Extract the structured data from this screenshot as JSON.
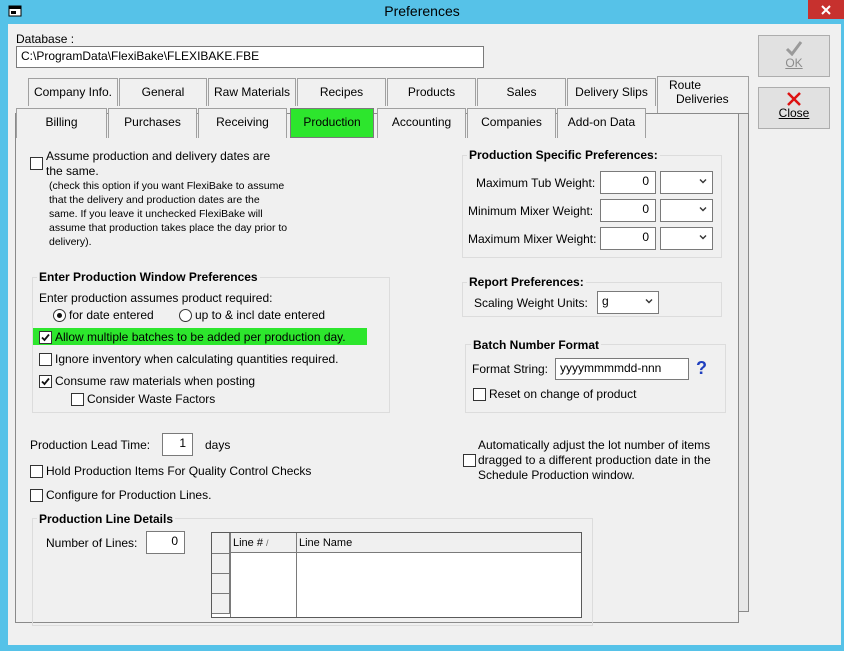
{
  "window": {
    "title": "Preferences"
  },
  "database": {
    "label": "Database :",
    "path": "C:\\ProgramData\\FlexiBake\\FLEXIBAKE.FBE"
  },
  "buttons": {
    "ok_label": "OK",
    "close_label": "Close"
  },
  "tabs_row1": [
    {
      "label": "Company Info."
    },
    {
      "label": "General"
    },
    {
      "label": "Raw Materials"
    },
    {
      "label": "Recipes"
    },
    {
      "label": "Products"
    },
    {
      "label": "Sales"
    },
    {
      "label": "Delivery Slips"
    },
    {
      "label_line1": "Route",
      "label_line2": "Deliveries"
    }
  ],
  "tabs_row2": [
    {
      "label": "Billing"
    },
    {
      "label": "Purchases"
    },
    {
      "label": "Receiving"
    },
    {
      "label": "Production",
      "active": true
    },
    {
      "label": "Accounting"
    },
    {
      "label": "Companies"
    },
    {
      "label": "Add-on Data"
    }
  ],
  "assume": {
    "label_line1": "Assume production and delivery dates are",
    "label_line2": "the same.",
    "note_lines": [
      "(check this option if you want FlexiBake to assume",
      "that the delivery and production dates are the",
      "same. If you leave it unchecked  FlexiBake will",
      "assume that production takes place the day prior to",
      "delivery)."
    ],
    "checked": false
  },
  "production_window": {
    "title": "Enter Production Window Preferences",
    "assumes_label": "Enter production assumes product required:",
    "radio_for_date": "for date entered",
    "radio_upto": "up to & incl date entered",
    "selected": "for date entered",
    "allow_multi": "Allow multiple batches to be added per production day.",
    "allow_multi_checked": true,
    "ignore_inventory": "Ignore inventory when calculating quantities required.",
    "ignore_inventory_checked": false,
    "consume_raw": "Consume raw materials when posting",
    "consume_raw_checked": true,
    "waste_factors": "Consider Waste Factors",
    "waste_factors_checked": false
  },
  "specific": {
    "title": "Production Specific Preferences:",
    "rows": [
      {
        "label": "Maximum Tub Weight:",
        "value": "0",
        "unit": ""
      },
      {
        "label": "Minimum Mixer Weight:",
        "value": "0",
        "unit": ""
      },
      {
        "label": "Maximum Mixer Weight:",
        "value": "0",
        "unit": ""
      }
    ]
  },
  "report": {
    "title": "Report Preferences:",
    "scaling_label": "Scaling Weight Units:",
    "scaling_value": "g"
  },
  "batch": {
    "title": "Batch Number Format",
    "format_label": "Format String:",
    "format_value": "yyyymmmmdd-nnn",
    "help": "?",
    "reset_label": "Reset on change of product",
    "reset_checked": false
  },
  "lead_time": {
    "label": "Production Lead Time:",
    "value": "1",
    "unit": "days"
  },
  "hold_qc": {
    "label": "Hold Production Items For Quality Control Checks",
    "checked": false
  },
  "config_lines": {
    "label": "Configure for Production Lines.",
    "checked": false
  },
  "auto_adjust": {
    "line1": "Automatically adjust the lot number of items",
    "line2": "dragged to a different production date in the",
    "line3": "Schedule Production window.",
    "checked": false
  },
  "line_details": {
    "title": "Production Line Details",
    "num_lines_label": "Number of Lines:",
    "num_lines_value": "0",
    "columns": [
      "Line #",
      "Line Name"
    ],
    "sort_glyph": "/"
  },
  "colors": {
    "title_bg": "#56c2e8",
    "close_bg": "#c7312e",
    "active_tab": "#2de62d",
    "highlight": "#2de62d",
    "help_blue": "#1f3fbf"
  }
}
